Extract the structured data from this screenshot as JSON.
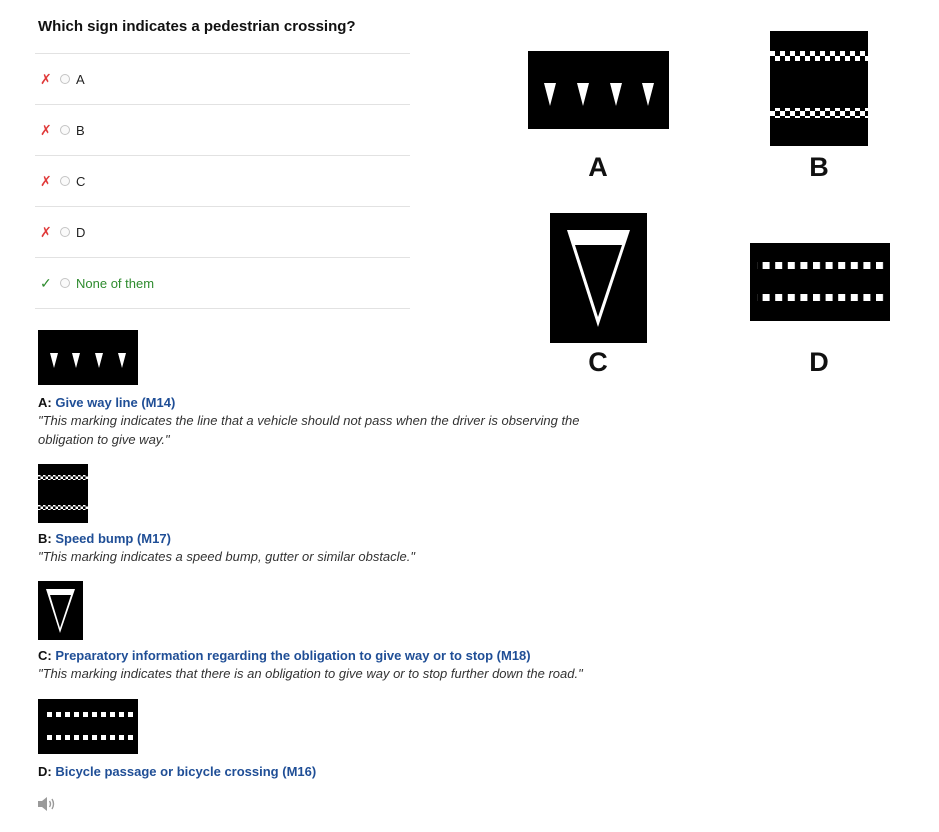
{
  "question": "Which sign indicates a pedestrian crossing?",
  "options": [
    {
      "label": "A",
      "status": "wrong"
    },
    {
      "label": "B",
      "status": "wrong"
    },
    {
      "label": "C",
      "status": "wrong"
    },
    {
      "label": "D",
      "status": "wrong"
    },
    {
      "label": "None of them",
      "status": "correct"
    }
  ],
  "marks": {
    "wrong": "✗",
    "correct": "✓"
  },
  "signs": {
    "a_letter": "A",
    "b_letter": "B",
    "c_letter": "C",
    "d_letter": "D"
  },
  "explanations": [
    {
      "letter": "A:",
      "title": "Give way line (M14)",
      "quote": "\"This marking indicates the line that a vehicle should not pass when the driver is observing the obligation to give way.\""
    },
    {
      "letter": "B:",
      "title": "Speed bump (M17)",
      "quote": "\"This marking indicates a speed bump, gutter or similar obstacle.\""
    },
    {
      "letter": "C:",
      "title": "Preparatory information regarding the obligation to give way or to stop (M18)",
      "quote": "\"This marking indicates that there is an obligation to give way or to stop further down the road.\""
    },
    {
      "letter": "D:",
      "title": "Bicycle passage or bicycle crossing (M16)",
      "quote": ""
    }
  ],
  "colors": {
    "wrong": "#e03a3a",
    "correct": "#2e8b2e",
    "link": "#1f4e96"
  },
  "icons": {
    "audio": "speaker-icon"
  }
}
